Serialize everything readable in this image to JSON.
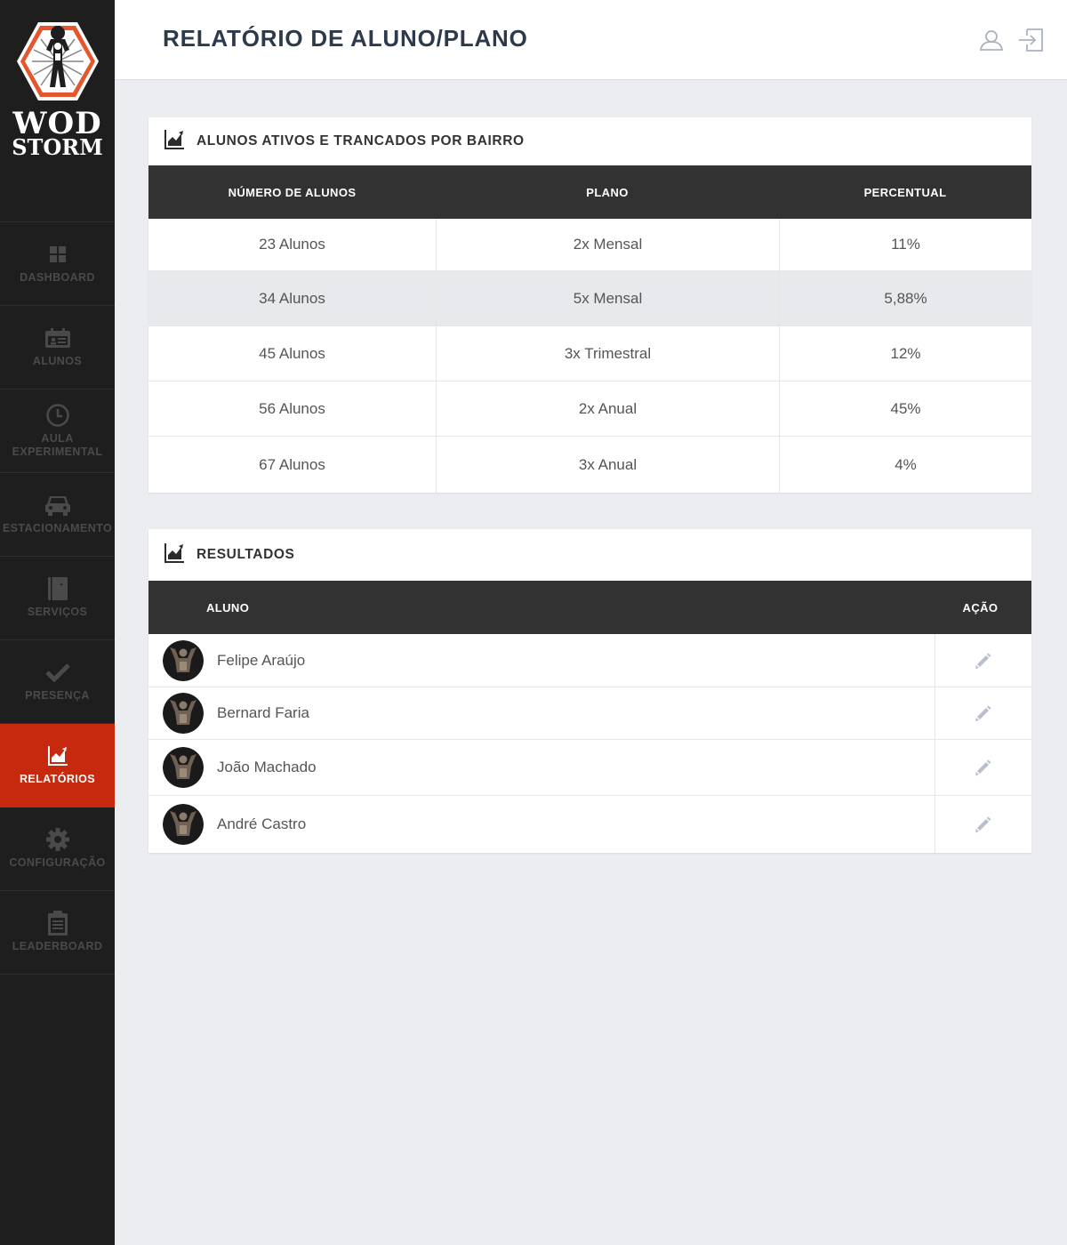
{
  "app": {
    "brand_line1": "WOD",
    "brand_line2": "STORM"
  },
  "sidebar": {
    "items": [
      {
        "label": "DASHBOARD",
        "icon": "grid-icon"
      },
      {
        "label": "ALUNOS",
        "icon": "id-card-icon"
      },
      {
        "label": "AULA EXPERIMENTAL",
        "icon": "clock-icon"
      },
      {
        "label": "ESTACIONAMENTO",
        "icon": "car-icon"
      },
      {
        "label": "SERVIÇOS",
        "icon": "book-icon"
      },
      {
        "label": "PRESENÇA",
        "icon": "check-icon"
      },
      {
        "label": "RELATÓRIOS",
        "icon": "chart-icon",
        "active": true
      },
      {
        "label": "CONFIGURAÇÃO",
        "icon": "gear-icon"
      },
      {
        "label": "LEADERBOARD",
        "icon": "clipboard-icon"
      }
    ]
  },
  "header": {
    "title": "RELATÓRIO DE ALUNO/PLANO",
    "icons": [
      "user-icon",
      "logout-icon"
    ]
  },
  "card1": {
    "title": "ALUNOS ATIVOS E TRANCADOS POR BAIRRO",
    "columns": [
      "NÚMERO DE ALUNOS",
      "PLANO",
      "PERCENTUAL"
    ],
    "rows": [
      {
        "alunos": "23 Alunos",
        "plano": "2x Mensal",
        "percentual": "11%"
      },
      {
        "alunos": "34 Alunos",
        "plano": "5x Mensal",
        "percentual": "5,88%"
      },
      {
        "alunos": "45 Alunos",
        "plano": "3x Trimestral",
        "percentual": "12%"
      },
      {
        "alunos": "56 Alunos",
        "plano": "2x Anual",
        "percentual": "45%"
      },
      {
        "alunos": "67 Alunos",
        "plano": "3x Anual",
        "percentual": "4%"
      }
    ]
  },
  "card2": {
    "title": "RESULTADOS",
    "columns": [
      "ALUNO",
      "AÇÃO"
    ],
    "rows": [
      {
        "name": "Felipe Araújo"
      },
      {
        "name": "Bernard Faria"
      },
      {
        "name": "João Machado"
      },
      {
        "name": "André Castro"
      }
    ]
  },
  "colors": {
    "accent": "#c7290e",
    "sidebar": "#1e1e1e",
    "table_header": "#323232",
    "background": "#ecedf1"
  }
}
